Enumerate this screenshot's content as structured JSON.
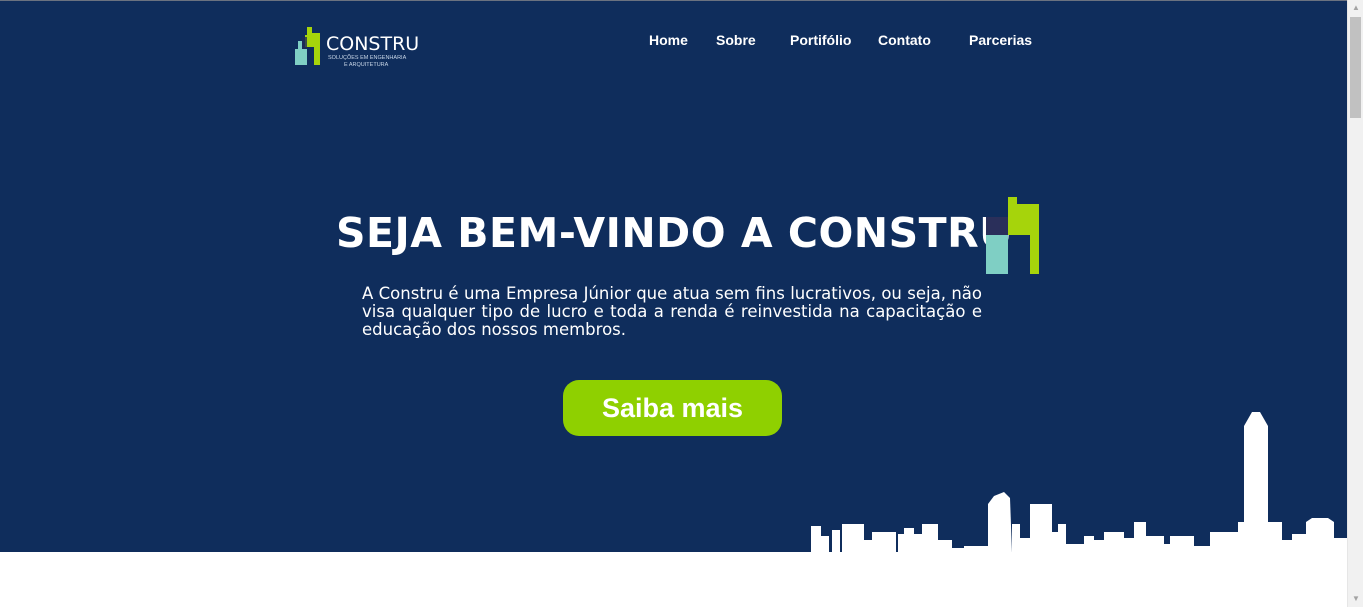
{
  "header": {
    "logo": {
      "name": "CONSTRU",
      "tagline_line1": "SOLUÇÕES EM ENGENHARIA",
      "tagline_line2": "E ARQUITETURA",
      "icon": "building-logo-icon"
    },
    "nav": [
      "Home",
      "Sobre",
      "Portifólio",
      "Contato",
      "Parcerias"
    ]
  },
  "hero": {
    "title": "SEJA BEM-VINDO A CONSTRU",
    "description": "A Constru é uma Empresa Júnior que atua sem fins lucrativos, ou seja, não visa qualquer tipo de lucro e toda a renda é reinvestida na capacitação e educação dos nossos membros.",
    "cta_label": "Saiba mais",
    "decoration": "city-skyline-icon"
  },
  "colors": {
    "hero_background": "#0f2d5c",
    "accent_green": "#8fd000",
    "logo_teal": "#7fcfc4",
    "text": "#ffffff"
  },
  "scrollbar": {
    "up_icon": "scroll-up-arrow-icon",
    "down_icon": "scroll-down-arrow-icon"
  }
}
